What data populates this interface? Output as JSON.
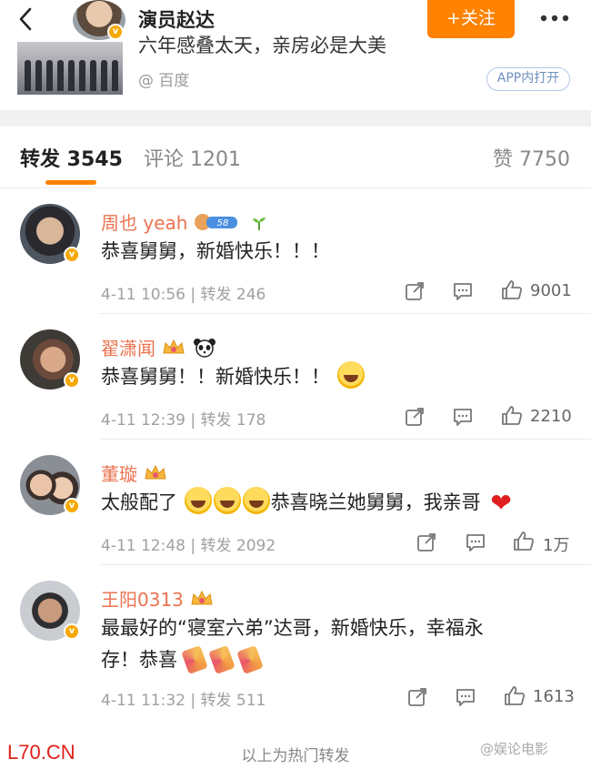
{
  "header": {
    "back_icon": "chevron-left-icon",
    "user_name": "演员赵达",
    "follow_label": "+关注",
    "more_icon": "more-dots-icon"
  },
  "card": {
    "title": "六年感叠太天，亲房必是大美",
    "source": "@ 百度",
    "app_open_label": "APP内打开"
  },
  "tabs": {
    "repost": "转发 3545",
    "comment": "评论 1201",
    "like": "赞 7750"
  },
  "comments": [
    {
      "name": "周也 yeah",
      "badge_level": "58",
      "text": "恭喜舅舅，新婚快乐！！！",
      "meta": "4-11 10:56 | 转发 246",
      "likes": "9001"
    },
    {
      "name": "翟潇闻",
      "text": "恭喜舅舅！！新婚快乐！！",
      "meta": "4-11 12:39 | 转发 178",
      "likes": "2210"
    },
    {
      "name": "董璇",
      "text_prefix": "太般配了",
      "text_suffix": "恭喜晓兰她舅舅，我亲哥",
      "meta": "4-11 12:48 | 转发 2092",
      "likes": "1万"
    },
    {
      "name": "王阳0313",
      "text_line1": "最最好的“寝室六弟”达哥，新婚快乐，幸福永",
      "text_line2": "存！恭喜",
      "meta": "4-11 11:32 | 转发 511",
      "likes": "1613"
    }
  ],
  "footer": {
    "hot_label": "以上为热门转发",
    "watermark_left": "L70.CN",
    "watermark_right": "@娱论电影"
  },
  "colors": {
    "accent": "#ff8200",
    "username": "#eb7350",
    "verified_badge": "#f7a800",
    "watermark_red": "#e0201a"
  }
}
